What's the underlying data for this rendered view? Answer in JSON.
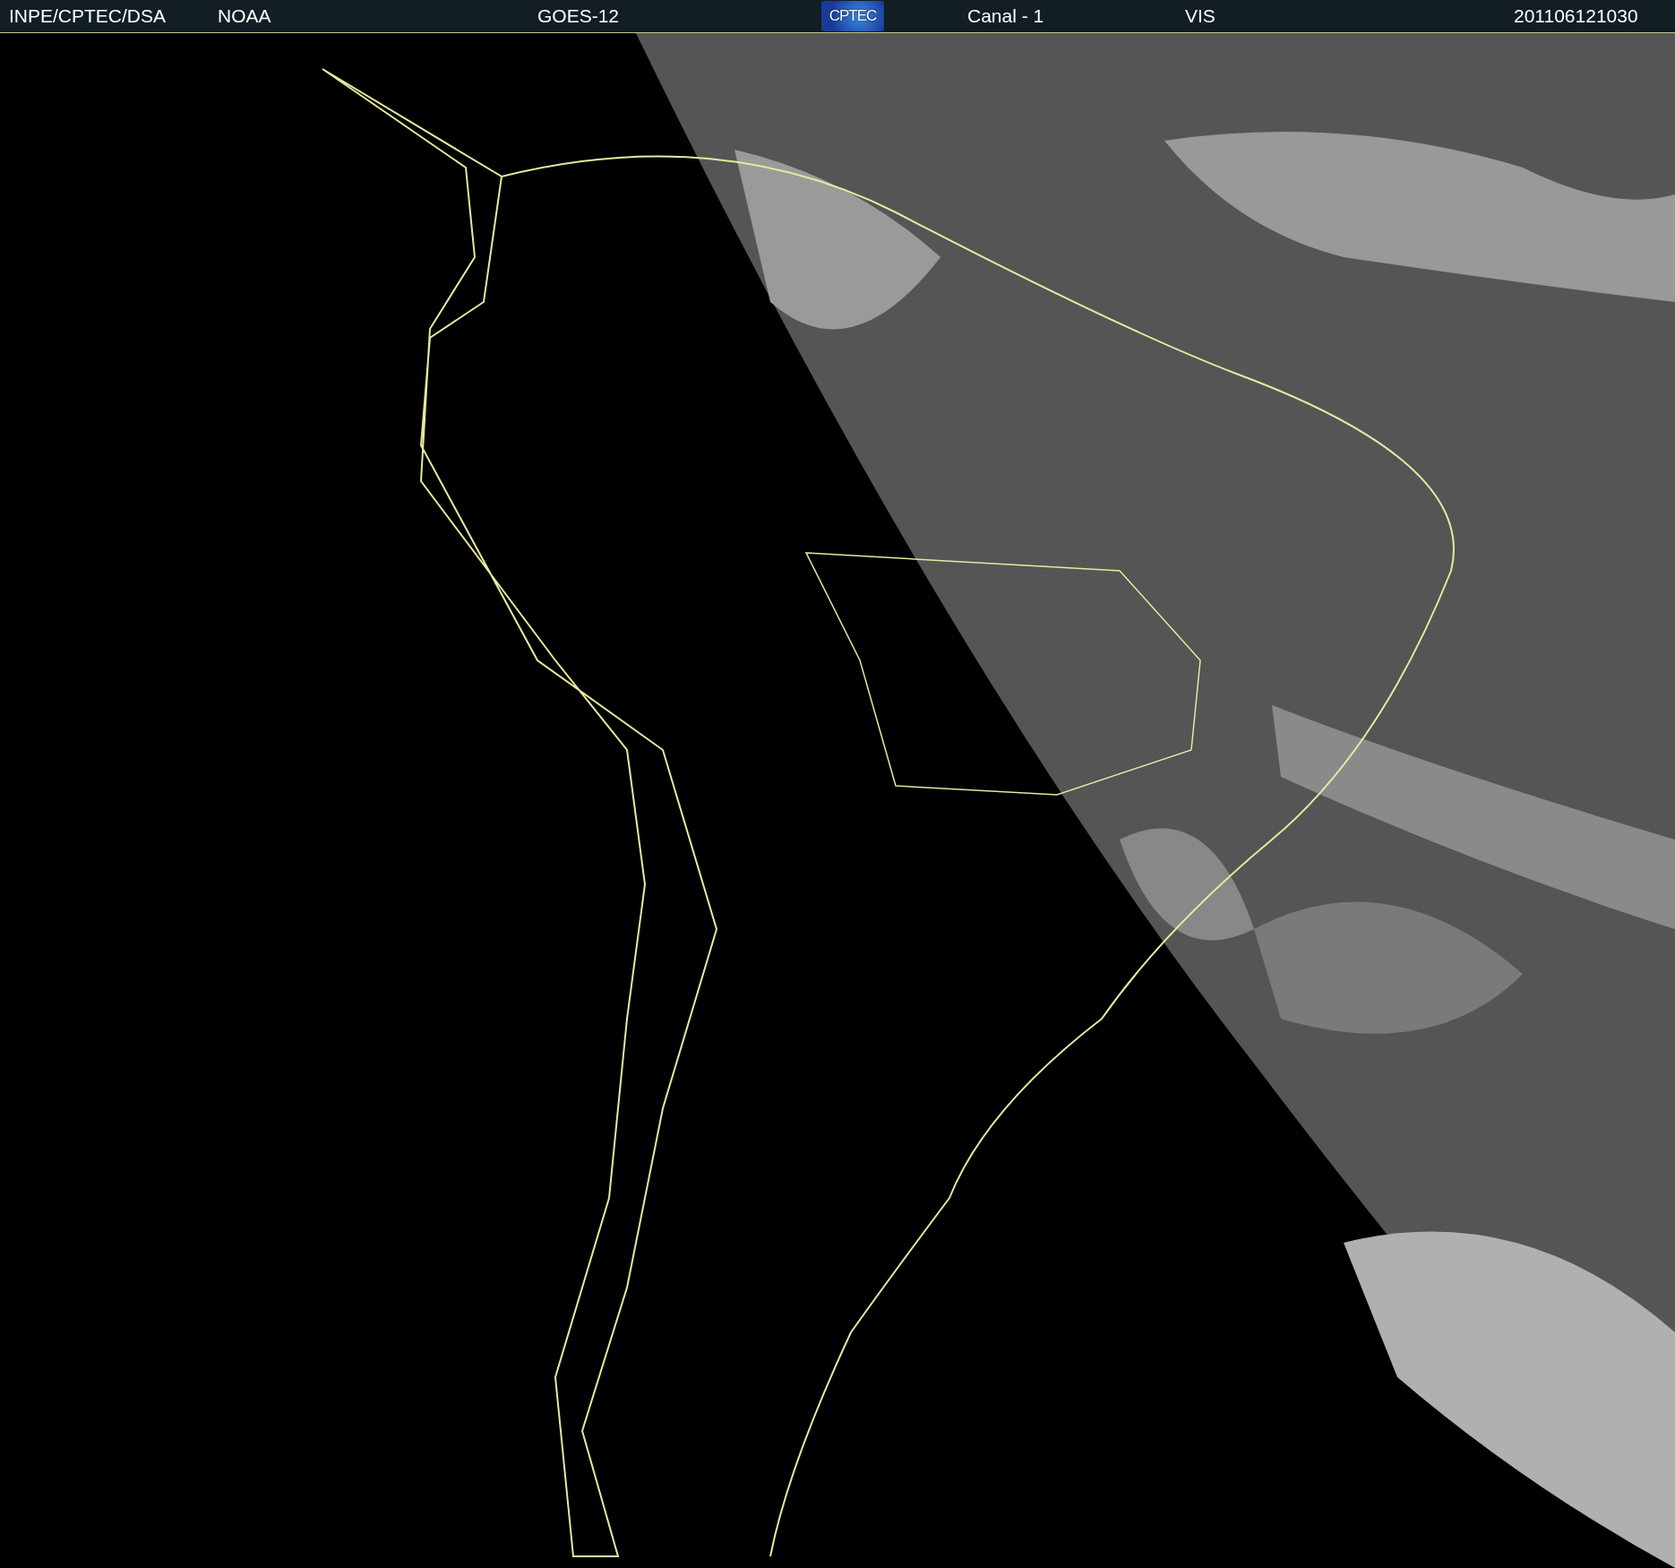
{
  "header": {
    "fields": [
      {
        "kind": "text",
        "text": "INPE/CPTEC/DSA"
      },
      {
        "kind": "text",
        "text": "NOAA"
      },
      {
        "kind": "text",
        "text": "GOES-12"
      },
      {
        "kind": "logo",
        "text": "CPTEC"
      },
      {
        "kind": "text",
        "text": "Canal - 1"
      },
      {
        "kind": "text",
        "text": "VIS"
      },
      {
        "kind": "text",
        "text": "201106121030"
      }
    ]
  }
}
